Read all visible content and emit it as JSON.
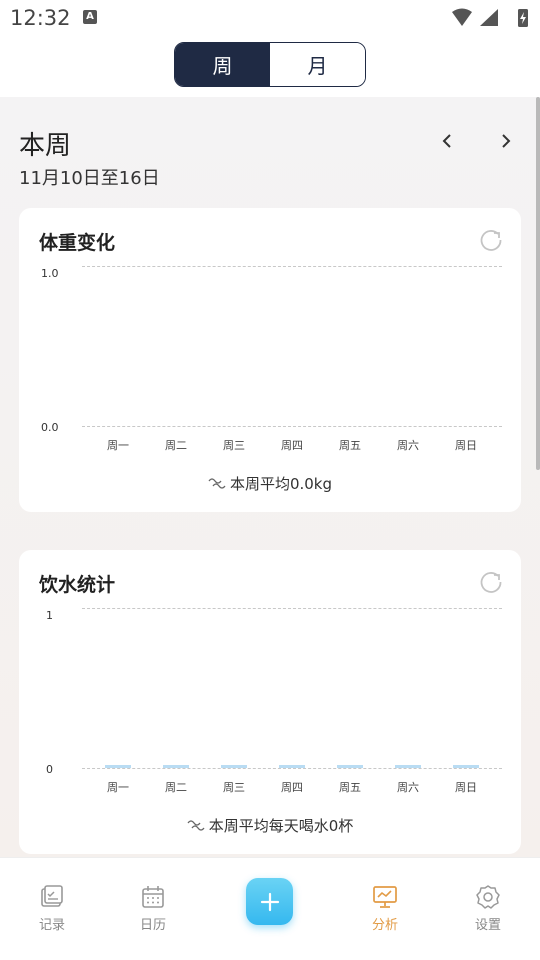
{
  "status": {
    "time": "12:32",
    "badge": "A"
  },
  "segment": {
    "week_label": "周",
    "month_label": "月",
    "active": "week"
  },
  "week": {
    "title": "本周",
    "range": "11月10日至16日"
  },
  "weight_card": {
    "title": "体重变化",
    "summary": "本周平均0.0kg",
    "chart_data": {
      "type": "line",
      "categories": [
        "周一",
        "周二",
        "周三",
        "周四",
        "周五",
        "周六",
        "周日"
      ],
      "y_ticks": [
        "1.0",
        "0.0"
      ],
      "ylim": [
        0,
        1
      ],
      "values": [],
      "grid": true
    }
  },
  "water_card": {
    "title": "饮水统计",
    "summary": "本周平均每天喝水0杯",
    "chart_data": {
      "type": "bar",
      "categories": [
        "周一",
        "周二",
        "周三",
        "周四",
        "周五",
        "周六",
        "周日"
      ],
      "y_ticks": [
        "1",
        "0"
      ],
      "ylim": [
        0,
        1
      ],
      "values": [
        0,
        0,
        0,
        0,
        0,
        0,
        0
      ],
      "bar_color": "#b9dcf3",
      "grid": true
    }
  },
  "tabs": [
    {
      "label": "记录",
      "icon": "record-icon"
    },
    {
      "label": "日历",
      "icon": "calendar-icon"
    },
    {
      "label": "分析",
      "icon": "analysis-icon",
      "active": true
    },
    {
      "label": "设置",
      "icon": "settings-icon"
    }
  ],
  "colors": {
    "primary": "#1f2a44",
    "accent": "#e29b45",
    "fab": "#35b8ef"
  }
}
